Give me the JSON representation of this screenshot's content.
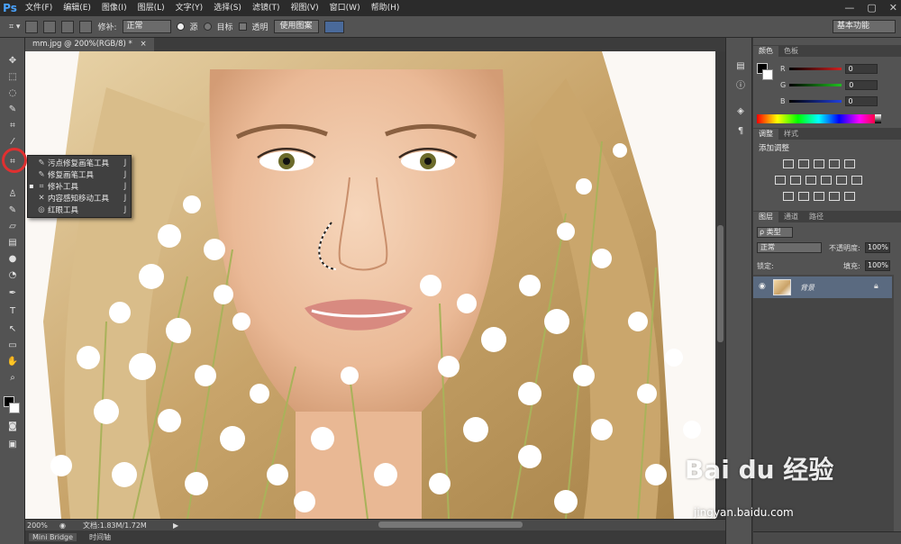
{
  "app": {
    "logo": "Ps"
  },
  "menu": [
    "文件(F)",
    "编辑(E)",
    "图像(I)",
    "图层(L)",
    "文字(Y)",
    "选择(S)",
    "滤镜(T)",
    "视图(V)",
    "窗口(W)",
    "帮助(H)"
  ],
  "window_controls": [
    "—",
    "▢",
    "✕"
  ],
  "options": {
    "patch_label": "修补:",
    "patch_mode": "正常",
    "source_label": "源",
    "dest_label": "目标",
    "transparent_label": "透明",
    "use_pattern_label": "使用图案",
    "workspace": "基本功能"
  },
  "document": {
    "tab_title": "mm.jpg @ 200%(RGB/8) *"
  },
  "status": {
    "zoom": "200%",
    "doc_info": "文档:1.83M/1.72M"
  },
  "bottom_tabs": [
    "Mini Bridge",
    "时间轴"
  ],
  "flyout": {
    "items": [
      {
        "label": "污点修复画笔工具",
        "key": "J",
        "icon": "spot-healing-brush-icon",
        "glyph": "✎",
        "active": false
      },
      {
        "label": "修复画笔工具",
        "key": "J",
        "icon": "healing-brush-icon",
        "glyph": "✎",
        "active": false
      },
      {
        "label": "修补工具",
        "key": "J",
        "icon": "patch-icon",
        "glyph": "⌗",
        "active": true
      },
      {
        "label": "内容感知移动工具",
        "key": "J",
        "icon": "content-aware-move-icon",
        "glyph": "✕",
        "active": false
      },
      {
        "label": "红眼工具",
        "key": "J",
        "icon": "red-eye-icon",
        "glyph": "◎",
        "active": false
      }
    ]
  },
  "color_panel": {
    "tabs": [
      "颜色",
      "色板"
    ],
    "channels": [
      {
        "name": "R",
        "value": "0",
        "color": "#d02020"
      },
      {
        "name": "G",
        "value": "0",
        "color": "#20c020"
      },
      {
        "name": "B",
        "value": "0",
        "color": "#2040e0"
      }
    ]
  },
  "adjust_panel": {
    "tabs": [
      "调整",
      "样式"
    ],
    "title": "添加调整"
  },
  "layers_panel": {
    "tabs": [
      "图层",
      "通道",
      "路径"
    ],
    "filter_label": "ρ 类型",
    "blend_mode": "正常",
    "opacity_label": "不透明度:",
    "opacity_value": "100%",
    "lock_label": "锁定:",
    "fill_label": "填充:",
    "fill_value": "100%",
    "layer_name": "背景"
  },
  "watermark": {
    "text": "Bai du 经验",
    "sub": "jingyan.baidu.com"
  },
  "colors": {
    "highlight": "#e03030",
    "panel": "#535353",
    "layer_selected": "#5a6a80"
  }
}
